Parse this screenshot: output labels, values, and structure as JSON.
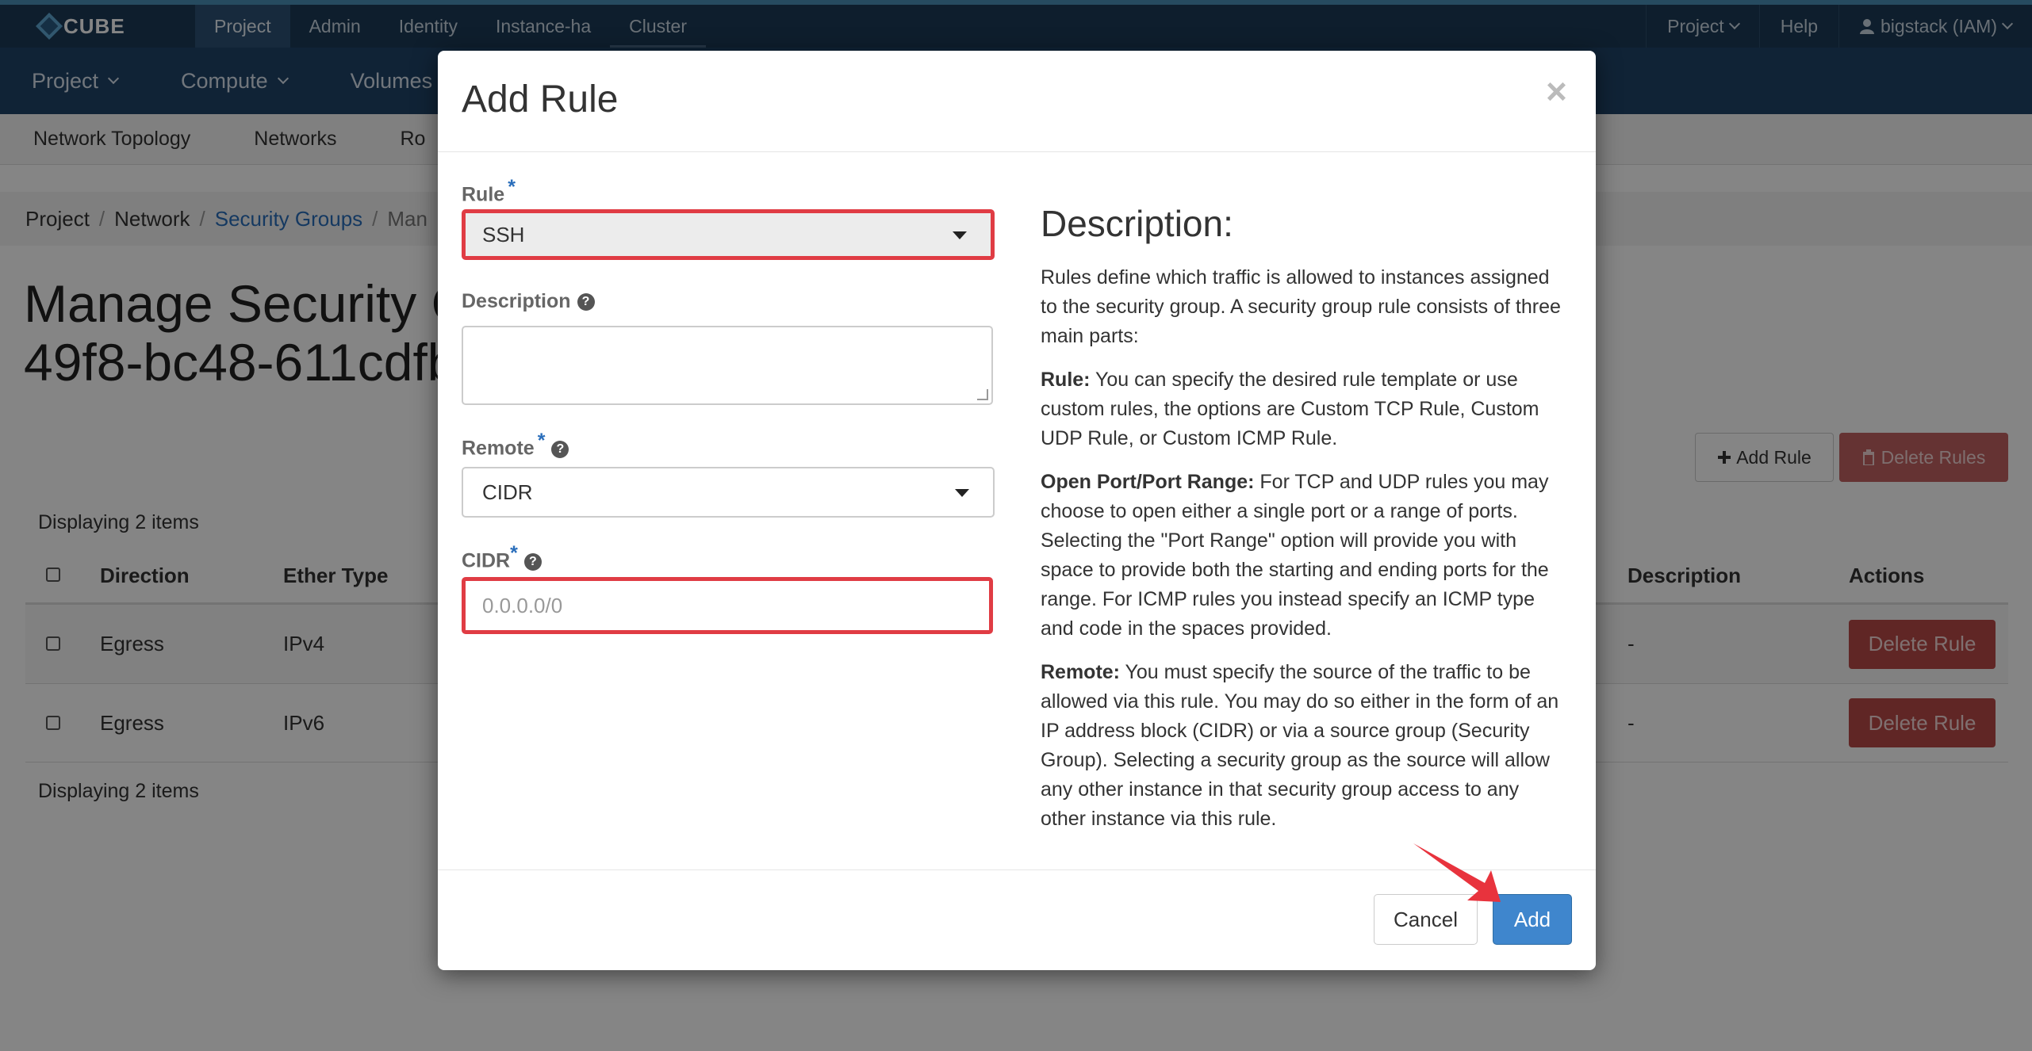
{
  "topbar": {
    "brand": "CUBE",
    "nav": [
      "Project",
      "Admin",
      "Identity",
      "Instance-ha",
      "Cluster"
    ],
    "right": {
      "project_label": "Project",
      "help_label": "Help",
      "user_label": "bigstack (IAM)"
    }
  },
  "secondbar": {
    "items": [
      "Project",
      "Compute",
      "Volumes"
    ]
  },
  "thirdbar": {
    "items": [
      "Network Topology",
      "Networks",
      "Ro"
    ]
  },
  "breadcrumb": {
    "items": [
      "Project",
      "Network",
      "Security Groups",
      "Man"
    ]
  },
  "page": {
    "title_line1": "Manage Security G",
    "title_line2": "49f8-bc48-611cdfb",
    "add_rule_label": "Add Rule",
    "delete_rules_label": "Delete Rules",
    "displaying_top": "Displaying 2 items",
    "displaying_bottom": "Displaying 2 items"
  },
  "table": {
    "headers": {
      "direction": "Direction",
      "ether_type": "Ether Type",
      "description": "Description",
      "actions": "Actions"
    },
    "rows": [
      {
        "direction": "Egress",
        "ether_type": "IPv4",
        "description": "-",
        "action": "Delete Rule"
      },
      {
        "direction": "Egress",
        "ether_type": "IPv6",
        "description": "-",
        "action": "Delete Rule"
      }
    ]
  },
  "modal": {
    "title": "Add Rule",
    "close_glyph": "×",
    "rule_label": "Rule",
    "rule_value": "SSH",
    "description_label": "Description",
    "remote_label": "Remote",
    "remote_value": "CIDR",
    "cidr_label": "CIDR",
    "cidr_placeholder": "0.0.0.0/0",
    "required_mark": "*",
    "help_glyph": "?",
    "desc_heading": "Description:",
    "desc_intro": "Rules define which traffic is allowed to instances assigned to the security group. A security group rule consists of three main parts:",
    "desc_rule_term": "Rule:",
    "desc_rule_text": " You can specify the desired rule template or use custom rules, the options are Custom TCP Rule, Custom UDP Rule, or Custom ICMP Rule.",
    "desc_port_term": "Open Port/Port Range:",
    "desc_port_text": " For TCP and UDP rules you may choose to open either a single port or a range of ports. Selecting the \"Port Range\" option will provide you with space to provide both the starting and ending ports for the range. For ICMP rules you instead specify an ICMP type and code in the spaces provided.",
    "desc_remote_term": "Remote:",
    "desc_remote_text": " You must specify the source of the traffic to be allowed via this rule. You may do so either in the form of an IP address block (CIDR) or via a source group (Security Group). Selecting a security group as the source will allow any other instance in that security group access to any other instance via this rule.",
    "cancel_label": "Cancel",
    "add_label": "Add"
  },
  "colors": {
    "highlight": "#e03c44",
    "primary": "#3f86cd",
    "danger": "#b94a48",
    "topbar": "#1b3a57"
  }
}
